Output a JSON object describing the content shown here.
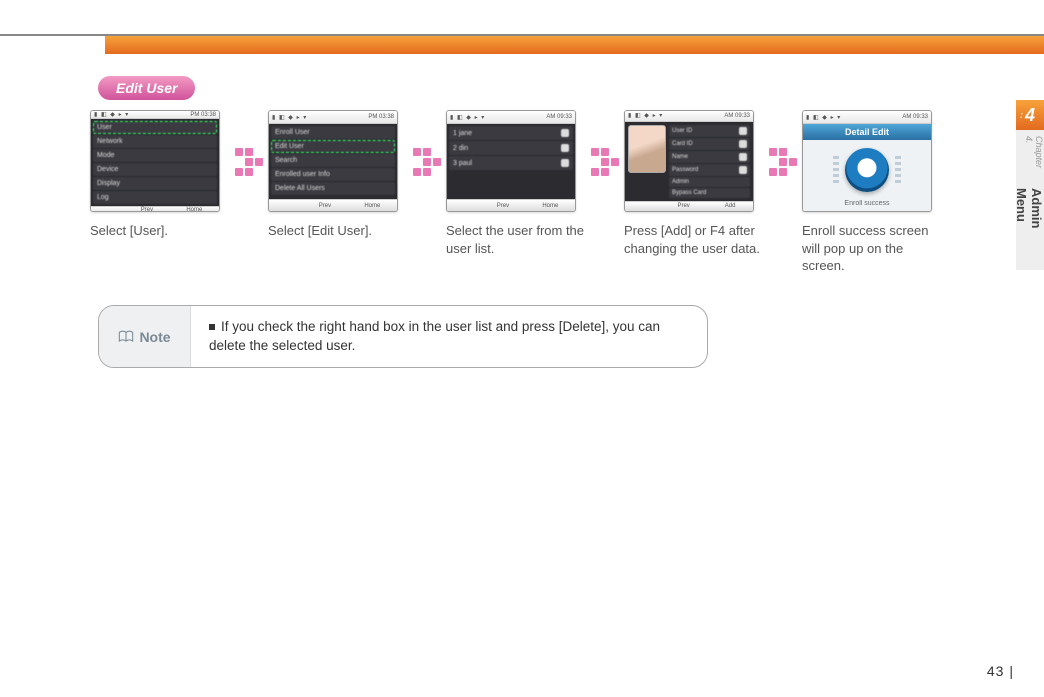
{
  "header": {
    "section_tag": "Edit User"
  },
  "steps": [
    {
      "caption": "Select [User].",
      "status_time": "PM 03:38",
      "rows": [
        "User",
        "Network",
        "Mode",
        "Device",
        "Display",
        "Log"
      ],
      "highlight_index": 0,
      "footer": [
        "",
        "Prev",
        "Home"
      ]
    },
    {
      "caption": "Select [Edit User].",
      "status_time": "PM 03:38",
      "rows": [
        "Enroll User",
        "Edit User",
        "Search",
        "Enrolled user Info",
        "Delete All Users"
      ],
      "highlight_index": 1,
      "footer": [
        "",
        "Prev",
        "Home"
      ]
    },
    {
      "caption": "Select the user from the user list.",
      "status_time": "AM 09:33",
      "rows": [
        "1    jane",
        "2    din",
        "3    paul"
      ],
      "checkboxes": true,
      "footer": [
        "",
        "Prev",
        "Home"
      ]
    },
    {
      "caption": "Press [Add] or F4 after changing the user data.",
      "status_time": "AM 09:33",
      "detail_rows": [
        "User ID",
        "Card ID",
        "Name",
        "Password",
        "Admin",
        "Bypass Card"
      ],
      "footer": [
        "",
        "Prev",
        "Add"
      ]
    },
    {
      "caption": "Enroll success screen will pop up on the screen.",
      "status_time": "AM 09:33",
      "success_title": "Detail Edit",
      "success_text": "Enroll success"
    }
  ],
  "note": {
    "label": "Note",
    "text": "If you check the right hand box in the user list and press [Delete], you can delete the selected user."
  },
  "side": {
    "chapter_number": "4",
    "chapter_label": "Chapter 4.",
    "chapter_title": "Admin Menu"
  },
  "page_number": "43"
}
